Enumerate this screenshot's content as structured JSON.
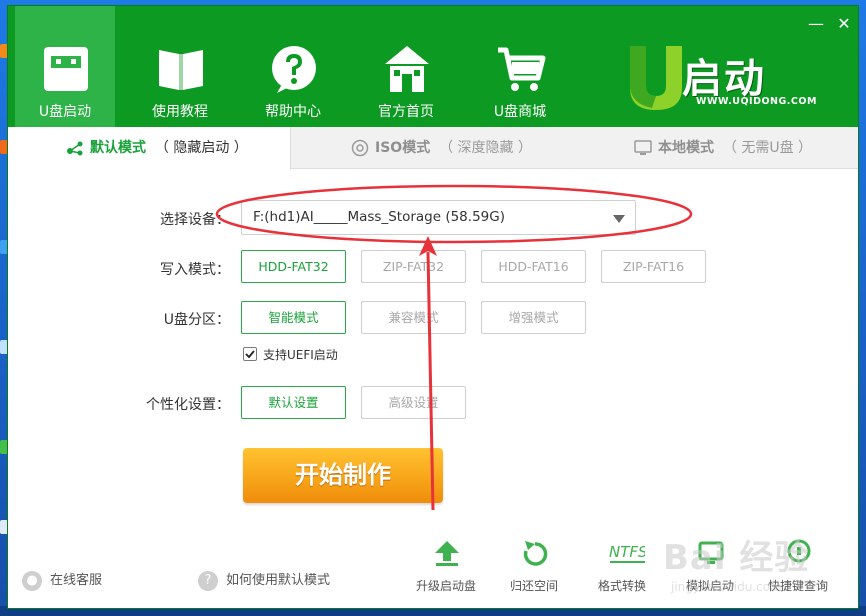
{
  "window": {
    "min_glyph": "—",
    "close_glyph": "✕"
  },
  "nav": {
    "items": [
      {
        "label": "U盘启动",
        "icon": "usb-drive-icon"
      },
      {
        "label": "使用教程",
        "icon": "book-icon"
      },
      {
        "label": "帮助中心",
        "icon": "help-icon"
      },
      {
        "label": "官方首页",
        "icon": "home-icon"
      },
      {
        "label": "U盘商城",
        "icon": "cart-icon"
      }
    ]
  },
  "logo": {
    "text": "启动",
    "url": "WWW.UQIDONG.COM"
  },
  "tabs": [
    {
      "label": "默认模式",
      "sub": "（ 隐藏启动 ）",
      "icon": "share-icon"
    },
    {
      "label": "ISO模式",
      "sub": "（ 深度隐藏 ）",
      "icon": "disc-icon"
    },
    {
      "label": "本地模式",
      "sub": "（ 无需U盘 ）",
      "icon": "monitor-icon"
    }
  ],
  "form": {
    "device_label": "选择设备：",
    "device_value": "F:(hd1)AI_____Mass_Storage (58.59G)",
    "write_label": "写入模式：",
    "write_options": [
      "HDD-FAT32",
      "ZIP-FAT32",
      "HDD-FAT16",
      "ZIP-FAT16"
    ],
    "partition_label": "U盘分区：",
    "partition_options": [
      "智能模式",
      "兼容模式",
      "增强模式"
    ],
    "uefi_label": "支持UEFI启动",
    "custom_label": "个性化设置：",
    "custom_options": [
      "默认设置",
      "高级设置"
    ],
    "start_label": "开始制作"
  },
  "footer": {
    "service": "在线客服",
    "howto": "如何使用默认模式",
    "tools": [
      {
        "label": "升级启动盘",
        "icon": "upload-icon"
      },
      {
        "label": "归还空间",
        "icon": "restore-icon"
      },
      {
        "label": "格式转换",
        "icon": "ntfs-icon"
      },
      {
        "label": "模拟启动",
        "icon": "simulate-icon"
      },
      {
        "label": "快捷键查询",
        "icon": "shortcut-icon"
      }
    ],
    "ntfs_text": "NTFS"
  },
  "watermark": {
    "text": "Bai 经验",
    "sub": "jingyan.baidu.com"
  },
  "colors": {
    "header_green": "#0d9a22",
    "accent_green": "#1aa23a",
    "button_orange": "#f8a51a",
    "annotation_red": "#e8323a"
  }
}
